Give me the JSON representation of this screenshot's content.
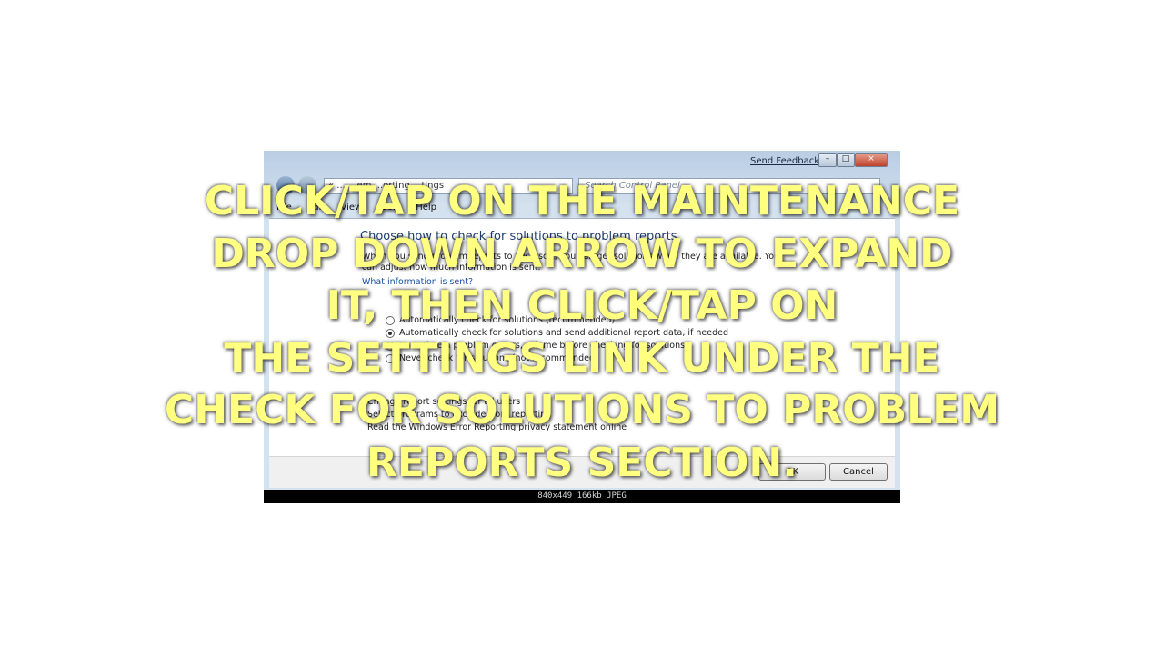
{
  "screenshot": {
    "titlebar": {
      "send_feedback": "Send Feedback",
      "minimize": "–",
      "maximize": "□",
      "close": "×"
    },
    "address": "« ... ...em ...orting ...tings",
    "search_placeholder": "Search Control Panel",
    "menu": [
      "File",
      "Edit",
      "View",
      "Tools",
      "Help"
    ],
    "content": {
      "heading": "Choose how to check for solutions to problem reports",
      "description": "When you send problem reports to Microsoft, you can get solutions when they are available. You can adjust how much information is sent.",
      "info_link": "What information is sent?",
      "options": [
        {
          "label": "Automatically check for solutions (recommended)",
          "selected": false
        },
        {
          "label": "Automatically check for solutions and send additional report data, if needed",
          "selected": true
        },
        {
          "label": "Each time a problem occurs, ask me before checking for solutions",
          "selected": false
        },
        {
          "label": "Never check for solutions (not recommended)",
          "selected": false
        }
      ],
      "more": [
        "Change report settings for all users",
        "Select programs to exclude from reporting",
        "Read the Windows Error Reporting privacy statement online"
      ]
    },
    "buttons": {
      "ok": "OK",
      "cancel": "Cancel"
    },
    "image_info": "840x449 166kb JPEG"
  },
  "overlay_lines": [
    "CLICK/TAP ON THE MAINTENANCE",
    "DROP DOWN ARROW TO EXPAND",
    "IT,  THEN CLICK/TAP ON",
    "THE SETTINGS LINK UNDER THE",
    "CHECK FOR SOLUTIONS TO PROBLEM",
    "REPORTS SECTION."
  ],
  "colors": {
    "overlay_text": "#ffff80"
  }
}
